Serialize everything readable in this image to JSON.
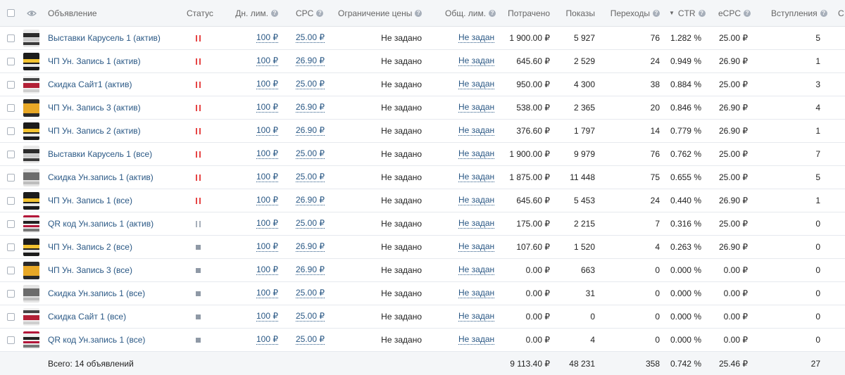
{
  "headers": {
    "ad": "Объявление",
    "status": "Статус",
    "daily_limit": "Дн. лим.",
    "cpc": "CPC",
    "price_limit": "Ограничение цены",
    "total_limit": "Общ. лим.",
    "spent": "Потрачено",
    "impressions": "Показы",
    "clicks": "Переходы",
    "ctr": "CTR",
    "ecpc": "eCPC",
    "joins": "Вступления",
    "next_col": "С"
  },
  "colors": {
    "link": "#2a5885",
    "pause_active": "#e64646",
    "pause_inactive": "#a7afba",
    "stopped": "#8f99a6"
  },
  "rows": [
    {
      "name": "Выставки Карусель 1 (актив)",
      "status": "paused-active",
      "thumb": "exhibit",
      "daily_limit": "100 ₽",
      "cpc": "25.00 ₽",
      "price_limit": "Не задано",
      "total_limit": "Не задан",
      "spent": "1 900.00 ₽",
      "impressions": "5 927",
      "clicks": "76",
      "ctr": "1.282 %",
      "ecpc": "25.00 ₽",
      "joins": "5"
    },
    {
      "name": "ЧП Ун. Запись 1 (актив)",
      "status": "paused-active",
      "thumb": "record",
      "daily_limit": "100 ₽",
      "cpc": "26.90 ₽",
      "price_limit": "Не задано",
      "total_limit": "Не задан",
      "spent": "645.60 ₽",
      "impressions": "2 529",
      "clicks": "24",
      "ctr": "0.949 %",
      "ecpc": "26.90 ₽",
      "joins": "1"
    },
    {
      "name": "Скидка Сайт1 (актив)",
      "status": "paused-active",
      "thumb": "sale",
      "daily_limit": "100 ₽",
      "cpc": "25.00 ₽",
      "price_limit": "Не задано",
      "total_limit": "Не задан",
      "spent": "950.00 ₽",
      "impressions": "4 300",
      "clicks": "38",
      "ctr": "0.884 %",
      "ecpc": "25.00 ₽",
      "joins": "3"
    },
    {
      "name": "ЧП Ун. Запись 3 (актив)",
      "status": "paused-active",
      "thumb": "gold",
      "daily_limit": "100 ₽",
      "cpc": "26.90 ₽",
      "price_limit": "Не задано",
      "total_limit": "Не задан",
      "spent": "538.00 ₽",
      "impressions": "2 365",
      "clicks": "20",
      "ctr": "0.846 %",
      "ecpc": "26.90 ₽",
      "joins": "4"
    },
    {
      "name": "ЧП Ун. Запись 2 (актив)",
      "status": "paused-active",
      "thumb": "record",
      "daily_limit": "100 ₽",
      "cpc": "26.90 ₽",
      "price_limit": "Не задано",
      "total_limit": "Не задан",
      "spent": "376.60 ₽",
      "impressions": "1 797",
      "clicks": "14",
      "ctr": "0.779 %",
      "ecpc": "26.90 ₽",
      "joins": "1"
    },
    {
      "name": "Выставки Карусель 1 (все)",
      "status": "paused-active",
      "thumb": "exhibit",
      "daily_limit": "100 ₽",
      "cpc": "25.00 ₽",
      "price_limit": "Не задано",
      "total_limit": "Не задан",
      "spent": "1 900.00 ₽",
      "impressions": "9 979",
      "clicks": "76",
      "ctr": "0.762 %",
      "ecpc": "25.00 ₽",
      "joins": "7"
    },
    {
      "name": "Скидка Ун.запись 1 (актив)",
      "status": "paused-active",
      "thumb": "grey",
      "daily_limit": "100 ₽",
      "cpc": "25.00 ₽",
      "price_limit": "Не задано",
      "total_limit": "Не задан",
      "spent": "1 875.00 ₽",
      "impressions": "11 448",
      "clicks": "75",
      "ctr": "0.655 %",
      "ecpc": "25.00 ₽",
      "joins": "5"
    },
    {
      "name": "ЧП Ун. Запись 1 (все)",
      "status": "paused-active",
      "thumb": "record",
      "daily_limit": "100 ₽",
      "cpc": "26.90 ₽",
      "price_limit": "Не задано",
      "total_limit": "Не задан",
      "spent": "645.60 ₽",
      "impressions": "5 453",
      "clicks": "24",
      "ctr": "0.440 %",
      "ecpc": "26.90 ₽",
      "joins": "1"
    },
    {
      "name": "QR код Ун.запись 1 (актив)",
      "status": "paused-inactive",
      "thumb": "qr",
      "daily_limit": "100 ₽",
      "cpc": "25.00 ₽",
      "price_limit": "Не задано",
      "total_limit": "Не задан",
      "spent": "175.00 ₽",
      "impressions": "2 215",
      "clicks": "7",
      "ctr": "0.316 %",
      "ecpc": "25.00 ₽",
      "joins": "0"
    },
    {
      "name": "ЧП Ун. Запись 2 (все)",
      "status": "stopped",
      "thumb": "record",
      "daily_limit": "100 ₽",
      "cpc": "26.90 ₽",
      "price_limit": "Не задано",
      "total_limit": "Не задан",
      "spent": "107.60 ₽",
      "impressions": "1 520",
      "clicks": "4",
      "ctr": "0.263 %",
      "ecpc": "26.90 ₽",
      "joins": "0"
    },
    {
      "name": "ЧП Ун. Запись 3 (все)",
      "status": "stopped",
      "thumb": "gold",
      "daily_limit": "100 ₽",
      "cpc": "26.90 ₽",
      "price_limit": "Не задано",
      "total_limit": "Не задан",
      "spent": "0.00 ₽",
      "impressions": "663",
      "clicks": "0",
      "ctr": "0.000 %",
      "ecpc": "0.00 ₽",
      "joins": "0"
    },
    {
      "name": "Скидка Ун.запись 1 (все)",
      "status": "stopped",
      "thumb": "grey",
      "daily_limit": "100 ₽",
      "cpc": "25.00 ₽",
      "price_limit": "Не задано",
      "total_limit": "Не задан",
      "spent": "0.00 ₽",
      "impressions": "31",
      "clicks": "0",
      "ctr": "0.000 %",
      "ecpc": "0.00 ₽",
      "joins": "0"
    },
    {
      "name": "Скидка Сайт 1 (все)",
      "status": "stopped",
      "thumb": "sale",
      "daily_limit": "100 ₽",
      "cpc": "25.00 ₽",
      "price_limit": "Не задано",
      "total_limit": "Не задан",
      "spent": "0.00 ₽",
      "impressions": "0",
      "clicks": "0",
      "ctr": "0.000 %",
      "ecpc": "0.00 ₽",
      "joins": "0"
    },
    {
      "name": "QR код Ун.запись 1 (все)",
      "status": "stopped",
      "thumb": "qr",
      "daily_limit": "100 ₽",
      "cpc": "25.00 ₽",
      "price_limit": "Не задано",
      "total_limit": "Не задан",
      "spent": "0.00 ₽",
      "impressions": "4",
      "clicks": "0",
      "ctr": "0.000 %",
      "ecpc": "0.00 ₽",
      "joins": "0"
    }
  ],
  "footer": {
    "label": "Всего: 14 объявлений",
    "spent": "9 113.40 ₽",
    "impressions": "48 231",
    "clicks": "358",
    "ctr": "0.742 %",
    "ecpc": "25.46 ₽",
    "joins": "27"
  }
}
